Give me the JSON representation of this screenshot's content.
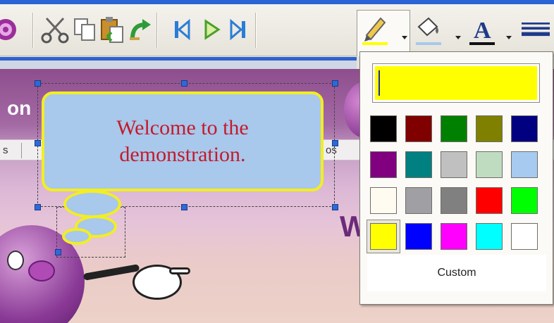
{
  "callout": {
    "text_line1": "Welcome to the",
    "text_line2": "demonstration."
  },
  "slide": {
    "partial_text_left": "on",
    "partial_text_bar_left": "s",
    "partial_text_bar_right": "os",
    "partial_text_right": "W"
  },
  "toolbar": {
    "icons": [
      "record-icon",
      "cut-icon",
      "copy-icon",
      "paste-icon",
      "undo-icon",
      "first-slide-icon",
      "play-icon",
      "last-slide-icon",
      "line-color-icon",
      "fill-color-icon",
      "font-color-icon",
      "line-style-icon"
    ]
  },
  "color_picker": {
    "current_color": "#ffff00",
    "selected_swatch": "#ffff00",
    "swatches": [
      "#000000",
      "#800000",
      "#008000",
      "#808000",
      "#000080",
      "#800080",
      "#008080",
      "#c0c0c0",
      "#c0dcc0",
      "#a6caf0",
      "#fffbf0",
      "#a0a0a4",
      "#808080",
      "#ff0000",
      "#00ff00",
      "#ffff00",
      "#0000ff",
      "#ff00ff",
      "#00ffff",
      "#ffffff"
    ],
    "custom_label": "Custom"
  },
  "colors": {
    "callout_fill": "#a8c8ec",
    "callout_border": "#f2ee22",
    "callout_text": "#c41a2a",
    "selection_handle": "#2e6ad6"
  }
}
